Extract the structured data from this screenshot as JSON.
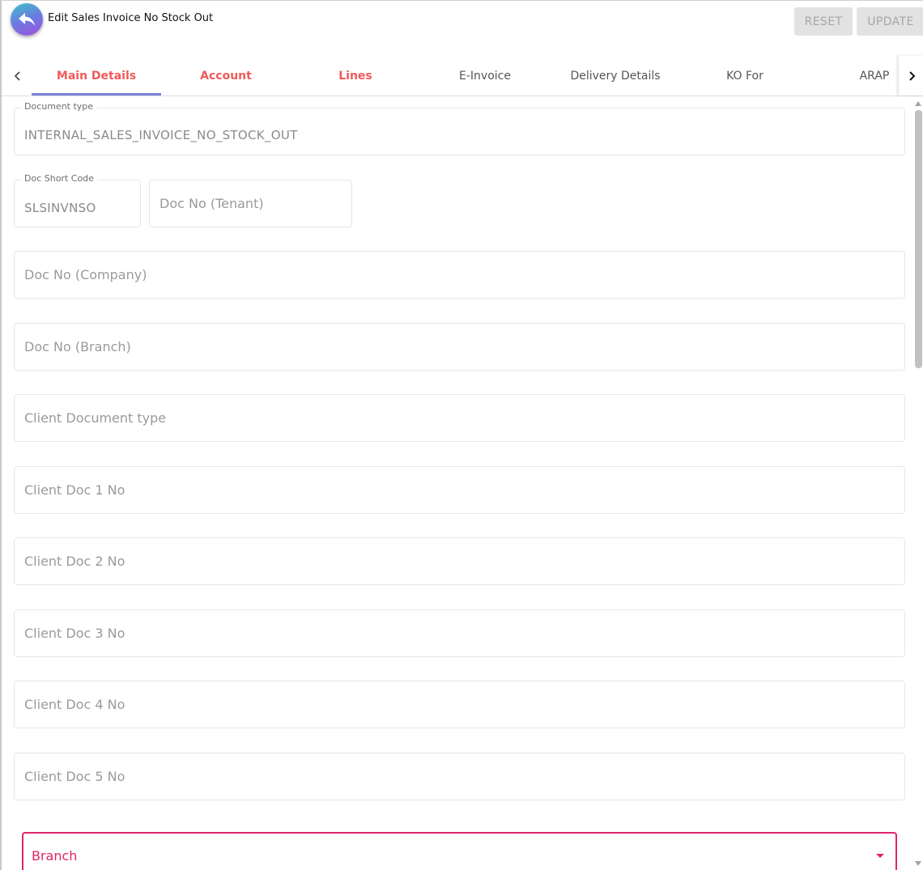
{
  "header": {
    "title": "Edit Sales Invoice No Stock Out",
    "reset_label": "RESET",
    "update_label": "UPDATE",
    "back_icon": "reply-arrow-icon"
  },
  "tabs": {
    "items": [
      {
        "label": "Main Details",
        "active": true
      },
      {
        "label": "Account"
      },
      {
        "label": "Lines"
      },
      {
        "label": "E-Invoice"
      },
      {
        "label": "Delivery Details"
      },
      {
        "label": "KO For"
      },
      {
        "label": "ARAP"
      }
    ],
    "accent_color": "#7b83d6",
    "highlight_color": "#f05a5a"
  },
  "form": {
    "document_type": {
      "label": "Document type",
      "value": "INTERNAL_SALES_INVOICE_NO_STOCK_OUT"
    },
    "doc_short_code": {
      "label": "Doc Short Code",
      "value": "SLSINVNSO"
    },
    "doc_no_tenant": {
      "placeholder": "Doc No (Tenant)"
    },
    "doc_no_company": {
      "placeholder": "Doc No (Company)"
    },
    "doc_no_branch": {
      "placeholder": "Doc No (Branch)"
    },
    "client_document_type": {
      "placeholder": "Client Document type"
    },
    "client_doc_1_no": {
      "placeholder": "Client Doc 1 No"
    },
    "client_doc_2_no": {
      "placeholder": "Client Doc 2 No"
    },
    "client_doc_3_no": {
      "placeholder": "Client Doc 3 No"
    },
    "client_doc_4_no": {
      "placeholder": "Client Doc 4 No"
    },
    "client_doc_5_no": {
      "placeholder": "Client Doc 5 No"
    },
    "branch": {
      "label": "Branch",
      "color": "#e0246b"
    }
  }
}
